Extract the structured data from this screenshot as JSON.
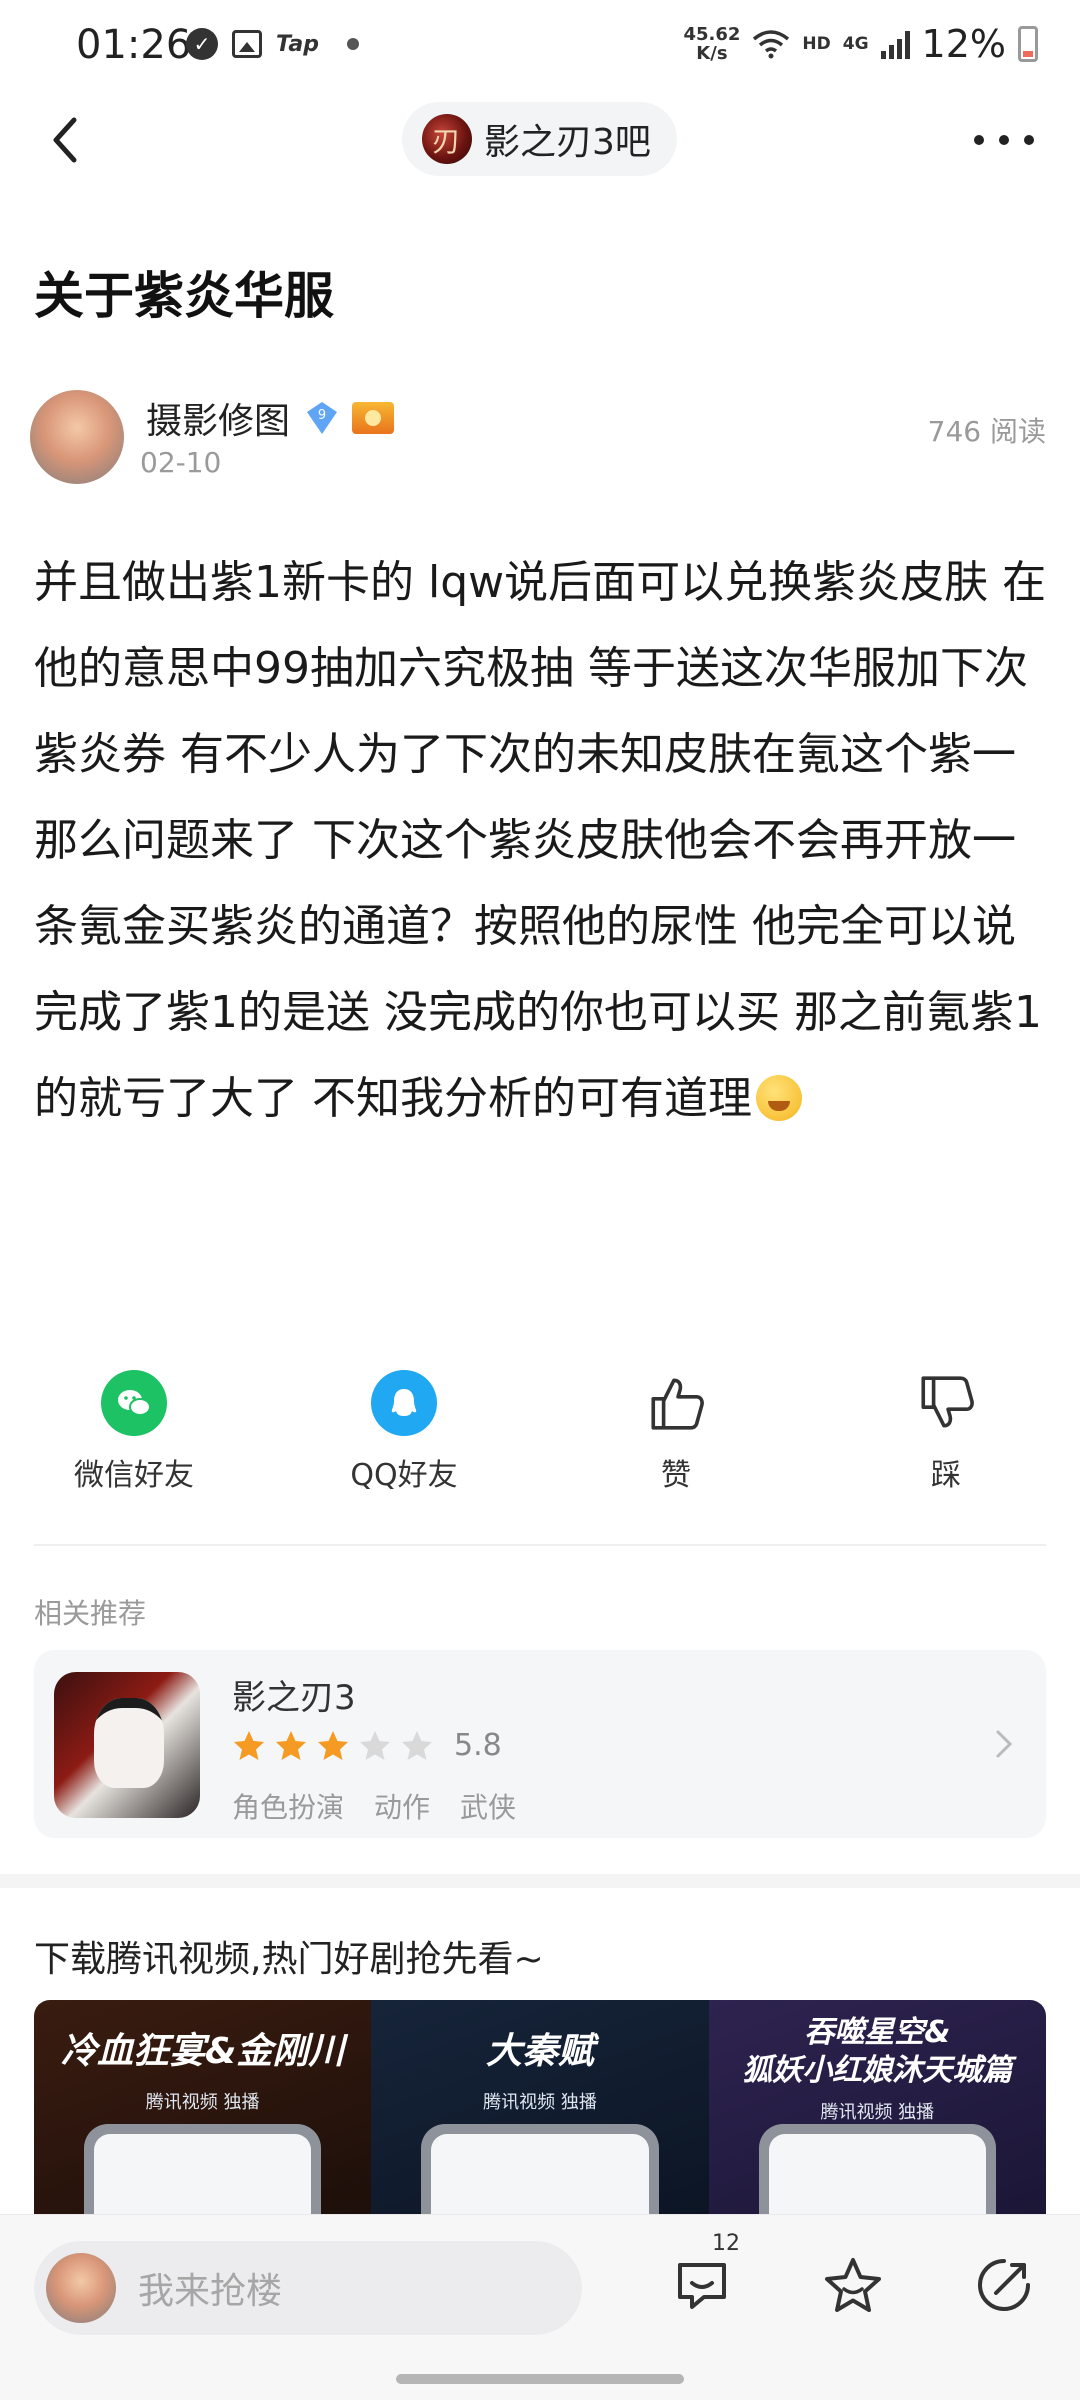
{
  "status_bar": {
    "time": "01:26",
    "tap_label": "Tap",
    "net_speed_value": "45.62",
    "net_speed_unit": "K/s",
    "hd_label": "HD",
    "network_type": "4G",
    "battery_percent": "12%"
  },
  "nav": {
    "forum_name": "影之刃3吧"
  },
  "post": {
    "title": "关于紫炎华服",
    "author_name": "摄影修图",
    "author_level": "9",
    "date": "02-10",
    "read_count": "746 阅读",
    "paragraph1": "并且做出紫1新卡的 lqw说后面可以兑换紫炎皮肤 在他的意思中99抽加六究极抽 等于送这次华服加下次紫炎券 有不少人为了下次的未知皮肤在氪这个紫一",
    "paragraph2": "那么问题来了 下次这个紫炎皮肤他会不会再开放一条氪金买紫炎的通道？按照他的尿性 他完全可以说完成了紫1的是送 没完成的你也可以买 那之前氪紫1的就亏了大了 不知我分析的可有道理"
  },
  "share": {
    "wechat": "微信好友",
    "qq": "QQ好友",
    "like": "赞",
    "dislike": "踩"
  },
  "related": {
    "label": "相关推荐",
    "game_name": "影之刃3",
    "rating": 3,
    "rating_max": 5,
    "score": "5.8",
    "tags": [
      "角色扮演",
      "动作",
      "武侠"
    ]
  },
  "ad": {
    "title": "下载腾讯视频,热门好剧抢先看~",
    "panels": [
      {
        "heading": "冷血狂宴&金刚川",
        "brand": "腾讯视频 独播"
      },
      {
        "heading": "大秦赋",
        "brand": "腾讯视频 独播"
      },
      {
        "heading": "吞噬星空&\n狐妖小红娘沐天城篇",
        "brand": "腾讯视频 独播"
      }
    ]
  },
  "bottom_bar": {
    "reply_placeholder": "我来抢楼",
    "comment_count": "12"
  },
  "colors": {
    "wechat_green": "#1cc264",
    "qq_blue": "#21a8f3",
    "star_orange": "#f59a23",
    "star_gray": "#d9d9d9"
  }
}
